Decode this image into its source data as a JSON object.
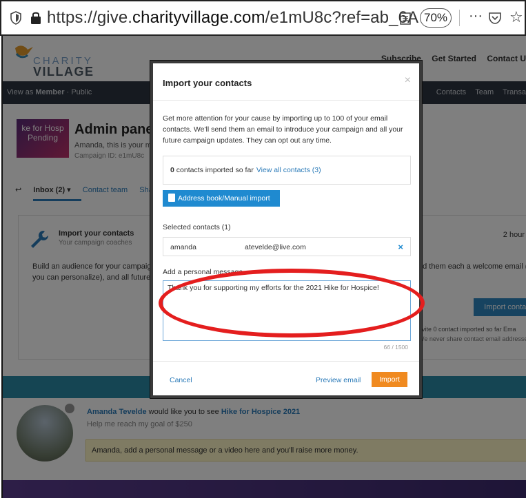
{
  "browser": {
    "url_prefix": "https://give.",
    "url_host": "charityvillage.com",
    "url_suffix": "/e1mU8c?ref=ab_6A",
    "zoom": "70%",
    "more": "···",
    "star": "☆"
  },
  "header": {
    "logo_line1": "CHARITY",
    "logo_line2": "VILLAGE",
    "links": [
      "Subscribe",
      "Get Started",
      "Contact U"
    ]
  },
  "navbar": {
    "view_as_prefix": "View as ",
    "view_as_member": "Member",
    "view_as_public": " · Public",
    "right_links": [
      "Contacts",
      "Team",
      "Transa"
    ]
  },
  "campaign": {
    "thumb_line1": "ke for Hosp",
    "thumb_status": "Pending",
    "title": "Admin panel",
    "subtitle": "Amanda, this is your mem",
    "campaign_id": "Campaign ID: e1mU8c"
  },
  "tabs": {
    "inbox": "Inbox (2) ▾",
    "contact_team": "Contact team",
    "share": "Sha"
  },
  "card": {
    "title": "Import your contacts",
    "subtitle": "Your campaign coaches",
    "time": "2 hour",
    "body1": "Build an audience for your campaign b",
    "body2": "you can personalize), and all future cam",
    "body3": "nd them each a welcome email (w",
    "import_button": "Import contact",
    "invite": "nvite   0 contact imported so far   Ema",
    "privacy": "We never share contact email addresse"
  },
  "promo": {
    "name": "Amanda Tevelde",
    "would_like": " would like you to see ",
    "campaign_link": "Hike for Hospice 2021",
    "goal": "Help me reach my goal of $250",
    "note": "Amanda, add a personal message or a video here and you'll raise more money."
  },
  "modal": {
    "title": "Import your contacts",
    "close": "×",
    "intro": "Get more attention for your cause by importing up to 100 of your email contacts. We'll send them an email to introduce your campaign and all your future campaign updates. They can opt out any time.",
    "count_number": "0",
    "count_text": " contacts imported so far",
    "view_all": "View all contacts (3)",
    "address_book_button": "Address book/Manual import",
    "selected_label": "Selected contacts (1)",
    "selected_name": "amanda",
    "selected_email": "atevelde@live.com",
    "remove": "×",
    "message_label": "Add a personal message",
    "message_value": "Thank you for supporting my efforts for the 2021 Hike for Hospice!",
    "char_count": "66 / 1500",
    "cancel": "Cancel",
    "preview": "Preview email",
    "import": "Import"
  }
}
